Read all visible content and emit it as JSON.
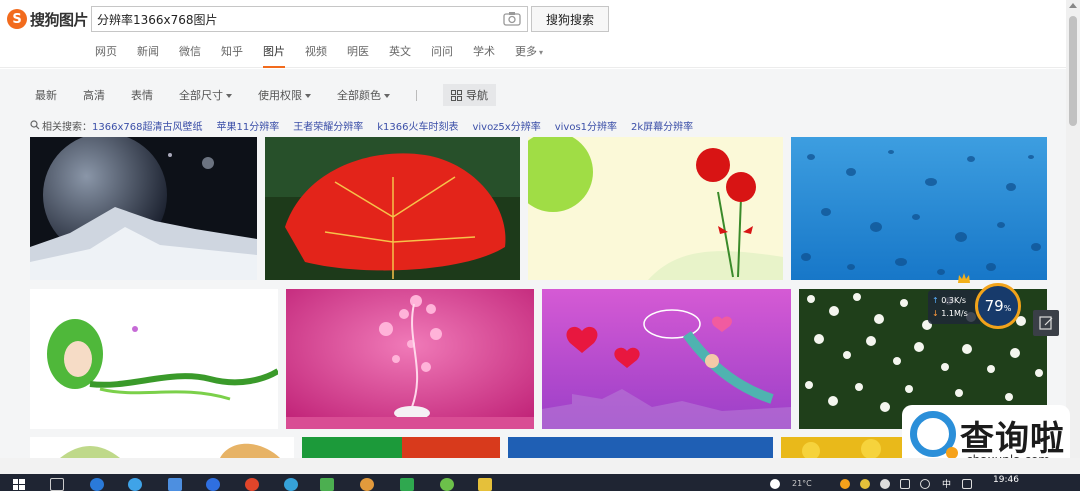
{
  "brand": {
    "logo_letter": "S",
    "name": "搜狗图片"
  },
  "search": {
    "query": "分辨率1366x768图片",
    "button_label": "搜狗搜索"
  },
  "nav": {
    "items": [
      "网页",
      "新闻",
      "微信",
      "知乎",
      "图片",
      "视频",
      "明医",
      "英文",
      "问问",
      "学术",
      "更多"
    ],
    "active": "图片"
  },
  "filters": {
    "items": [
      "最新",
      "高清",
      "表情",
      "全部尺寸",
      "使用权限",
      "全部颜色"
    ],
    "with_dropdown": [
      "全部尺寸",
      "使用权限",
      "全部颜色"
    ],
    "nav_button": "导航"
  },
  "related": {
    "label": "相关搜索：",
    "links": [
      "1366x768超清古风壁纸",
      "苹果11分辨率",
      "王者荣耀分辨率",
      "k1366火车时刻表",
      "vivoz5x分辨率",
      "vivos1分辨率",
      "2k屏幕分辨率"
    ]
  },
  "images": [
    "planet-moon-snow-mountain",
    "red-leaf",
    "red-carnations",
    "water-droplets-blue",
    "green-fairy-girl",
    "pink-hearts-lamp",
    "purple-butterfly-net-angel",
    "white-daisies-field",
    "partial-tropical",
    "partial-green-red",
    "partial-blue",
    "partial-yellow-flowers"
  ],
  "overlay": {
    "upload": "0.3K/s",
    "download": "1.1M/s",
    "percent": "79",
    "percent_sign": "%"
  },
  "watermark": {
    "cn": "查询啦",
    "en": "chaxunla.com"
  },
  "taskbar": {
    "temperature": "21°C",
    "ime": "中",
    "clock": "19:46"
  },
  "colors": {
    "brand_orange": "#f26b1d",
    "link_blue": "#3b4fa8",
    "gauge_ring": "#f2a31b"
  }
}
